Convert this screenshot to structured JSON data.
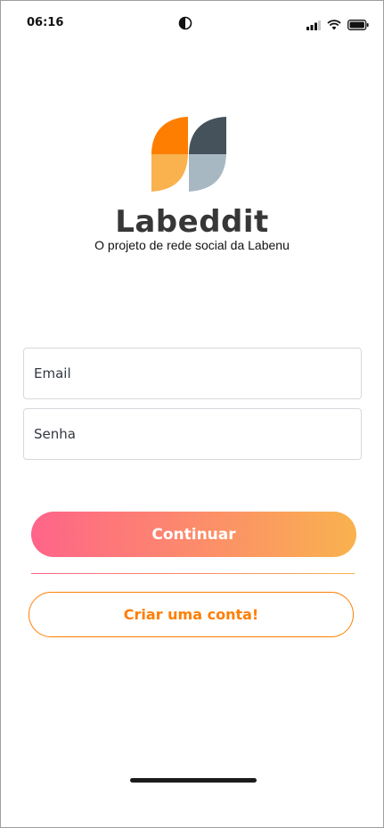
{
  "status_bar": {
    "time": "06:16",
    "center_icon": "contrast-icon",
    "icons": [
      "signal-icon",
      "wifi-icon",
      "battery-icon"
    ]
  },
  "brand": {
    "logo_icon": "labeddit-logo",
    "title": "Labeddit",
    "subtitle": "O projeto de rede social da Labenu",
    "colors": {
      "orange": "#fe7e02",
      "light_orange": "#f9b24e",
      "dark": "#45525b",
      "light_gray": "#a8b8c3"
    }
  },
  "form": {
    "email_placeholder": "Email",
    "password_placeholder": "Senha"
  },
  "actions": {
    "continue_label": "Continuar",
    "create_account_label": "Criar uma conta!",
    "gradient_start": "#ff6489",
    "gradient_end": "#f9b24e"
  }
}
